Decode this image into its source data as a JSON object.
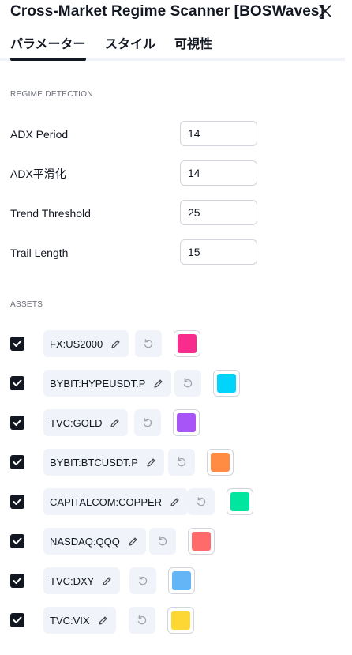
{
  "dialog": {
    "title": "Cross-Market Regime Scanner [BOSWaves]"
  },
  "tabs": [
    {
      "label": "パラメーター",
      "active": true
    },
    {
      "label": "スタイル",
      "active": false
    },
    {
      "label": "可視性",
      "active": false
    }
  ],
  "regime": {
    "heading": "REGIME DETECTION",
    "fields": [
      {
        "label": "ADX Period",
        "value": "14"
      },
      {
        "label": "ADX平滑化",
        "value": "14"
      },
      {
        "label": "Trend Threshold",
        "value": "25"
      },
      {
        "label": "Trail Length",
        "value": "15"
      }
    ]
  },
  "assets": {
    "heading": "ASSETS",
    "items": [
      {
        "symbol": "FX:US2000",
        "color": "#f72c8d",
        "checked": true
      },
      {
        "symbol": "BYBIT:HYPEUSDT.P",
        "color": "#00d4fa",
        "checked": true
      },
      {
        "symbol": "TVC:GOLD",
        "color": "#a855f7",
        "checked": true
      },
      {
        "symbol": "BYBIT:BTCUSDT.P",
        "color": "#ff8c42",
        "checked": true
      },
      {
        "symbol": "CAPITALCOM:COPPER",
        "color": "#00e6a0",
        "checked": true
      },
      {
        "symbol": "NASDAQ:QQQ",
        "color": "#ff6b6b",
        "checked": true
      },
      {
        "symbol": "TVC:DXY",
        "color": "#64b5f6",
        "checked": true
      },
      {
        "symbol": "TVC:VIX",
        "color": "#fdd835",
        "checked": true
      }
    ]
  }
}
